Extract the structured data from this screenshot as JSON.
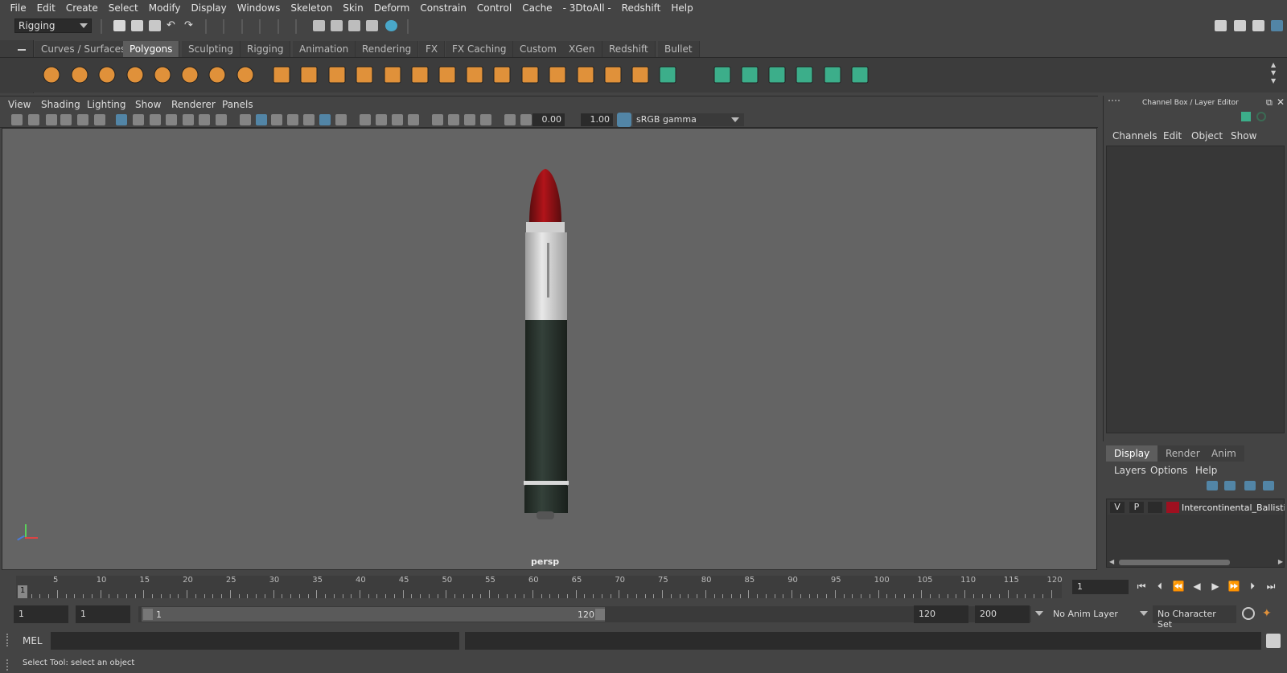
{
  "menubar": [
    "File",
    "Edit",
    "Create",
    "Select",
    "Modify",
    "Display",
    "Windows",
    "Skeleton",
    "Skin",
    "Deform",
    "Constrain",
    "Control",
    "Cache",
    "- 3DtoAll -",
    "Redshift",
    "Help"
  ],
  "mode_selector": "Rigging",
  "shelf_tabs": [
    "Curves / Surfaces",
    "Polygons",
    "Sculpting",
    "Rigging",
    "Animation",
    "Rendering",
    "FX",
    "FX Caching",
    "Custom",
    "XGen",
    "Redshift",
    "Bullet"
  ],
  "active_shelf_tab": "Polygons",
  "viewport": {
    "menus": [
      "View",
      "Shading",
      "Lighting",
      "Show",
      "Renderer",
      "Panels"
    ],
    "exposure": "0.00",
    "gamma": "1.00",
    "color_space": "sRGB gamma",
    "camera": "persp"
  },
  "channel_box": {
    "title": "Channel Box / Layer Editor",
    "menus": [
      "Channels",
      "Edit",
      "Object",
      "Show"
    ]
  },
  "layer_editor": {
    "tabs": [
      "Display",
      "Render",
      "Anim"
    ],
    "active_tab": "Display",
    "menus": [
      "Layers",
      "Options",
      "Help"
    ],
    "layer": {
      "v": "V",
      "p": "P",
      "color": "#9e1020",
      "name": "Intercontinental_Ballistic"
    }
  },
  "timeline": {
    "ticks": [
      "5",
      "10",
      "15",
      "20",
      "25",
      "30",
      "35",
      "40",
      "45",
      "50",
      "55",
      "60",
      "65",
      "70",
      "75",
      "80",
      "85",
      "90",
      "95",
      "100",
      "105",
      "110",
      "115",
      "120"
    ],
    "start_label": "1",
    "current_frame": "1"
  },
  "range": {
    "start": "1",
    "playback_start": "1",
    "slider_start": "1",
    "slider_end": "120",
    "playback_end": "120",
    "end": "200",
    "anim_layer": "No Anim Layer",
    "character_set": "No Character Set"
  },
  "command": {
    "label": "MEL"
  },
  "help_line": "Select Tool: select an object",
  "colors": {
    "accent": "#5285a6",
    "shelf_orange": "#e0913a",
    "shelf_green": "#3cae8a"
  }
}
